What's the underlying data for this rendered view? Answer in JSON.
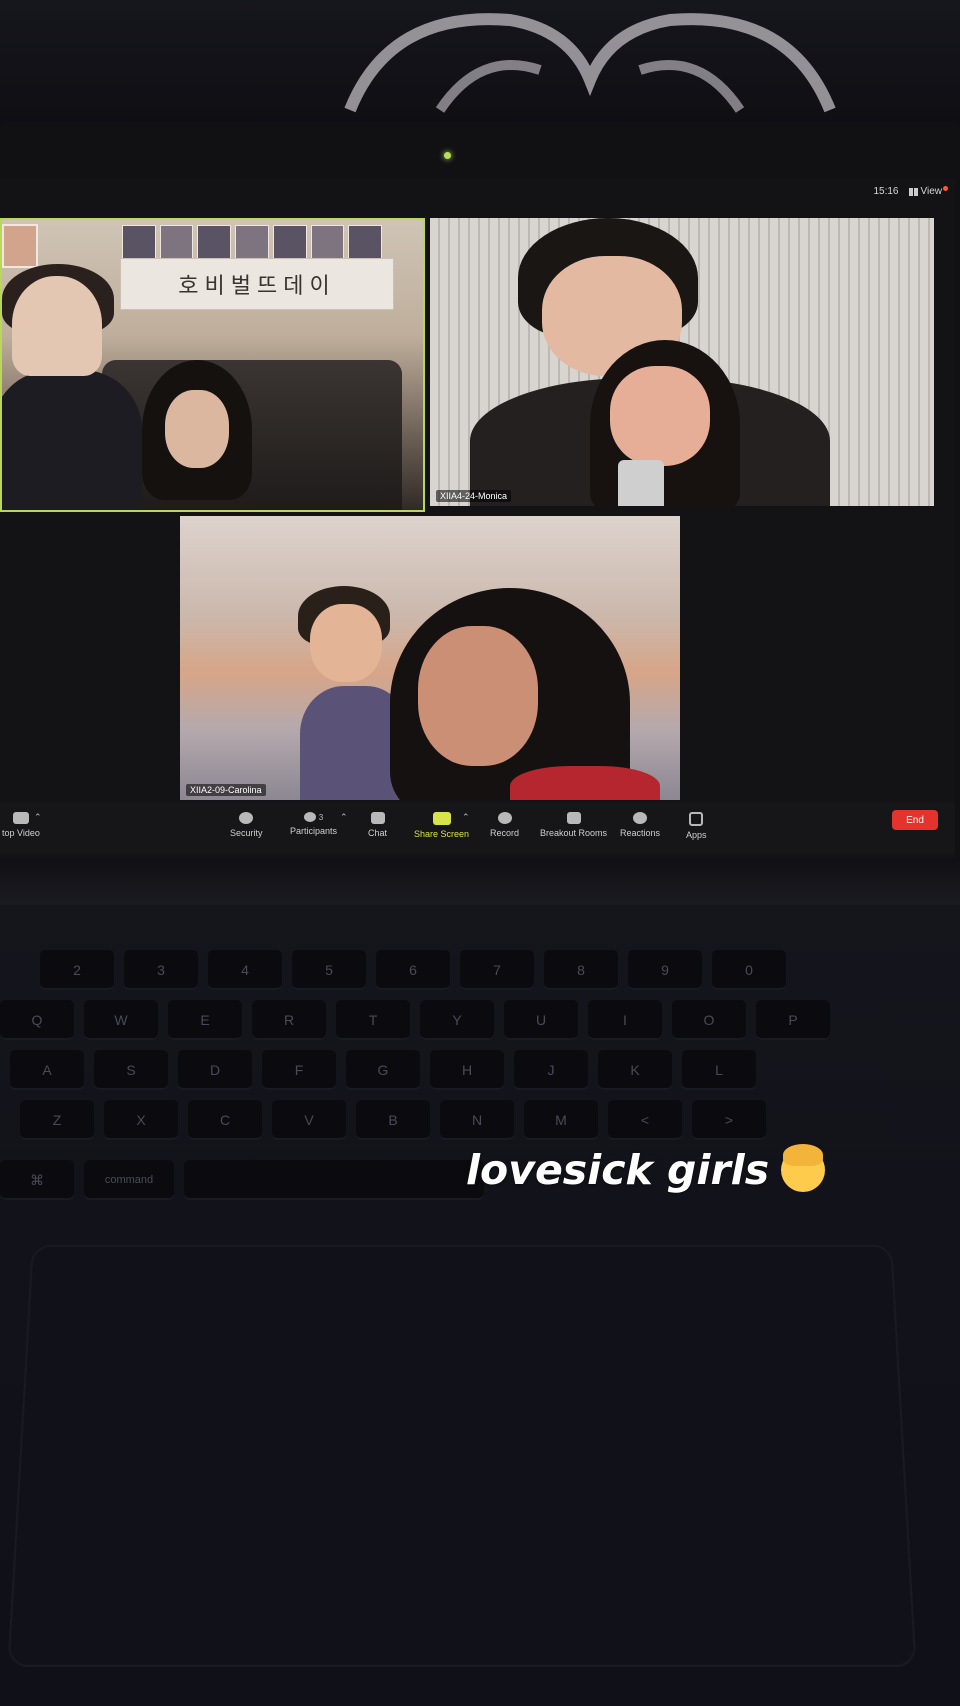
{
  "meeting": {
    "time": "15:16",
    "view_label": "View"
  },
  "tiles": [
    {
      "banner_text": "호비벌뜨데이",
      "name": ""
    },
    {
      "name": "XIIA4-24-Monica"
    },
    {
      "name": "XIIA2-09-Carolina"
    }
  ],
  "toolbar": {
    "video_label": "top Video",
    "participants_count": "3",
    "items": [
      {
        "label": "Security",
        "icon": "shield-icon"
      },
      {
        "label": "Participants",
        "icon": "people-icon"
      },
      {
        "label": "Chat",
        "icon": "chat-icon"
      },
      {
        "label": "Share Screen",
        "icon": "share-screen-icon"
      },
      {
        "label": "Record",
        "icon": "record-icon"
      },
      {
        "label": "Breakout Rooms",
        "icon": "breakout-icon"
      },
      {
        "label": "Reactions",
        "icon": "reactions-icon"
      },
      {
        "label": "Apps",
        "icon": "apps-icon"
      }
    ],
    "end_label": "End",
    "share_color": "#d8e24a",
    "end_color": "#e3332c"
  },
  "keyboard": {
    "row1": [
      "2",
      "3",
      "4",
      "5",
      "6",
      "7",
      "8",
      "9",
      "0"
    ],
    "row2": [
      "Q",
      "W",
      "E",
      "R",
      "T",
      "Y",
      "U",
      "I",
      "O",
      "P"
    ],
    "row3": [
      "A",
      "S",
      "D",
      "F",
      "G",
      "H",
      "J",
      "K",
      "L"
    ],
    "row4": [
      "Z",
      "X",
      "C",
      "V",
      "B",
      "N",
      "M",
      "<",
      ">"
    ],
    "row5": [
      "⌘",
      "command"
    ]
  },
  "caption": {
    "text": "lovesick girls",
    "emoji": "blonde-child-emoji"
  }
}
